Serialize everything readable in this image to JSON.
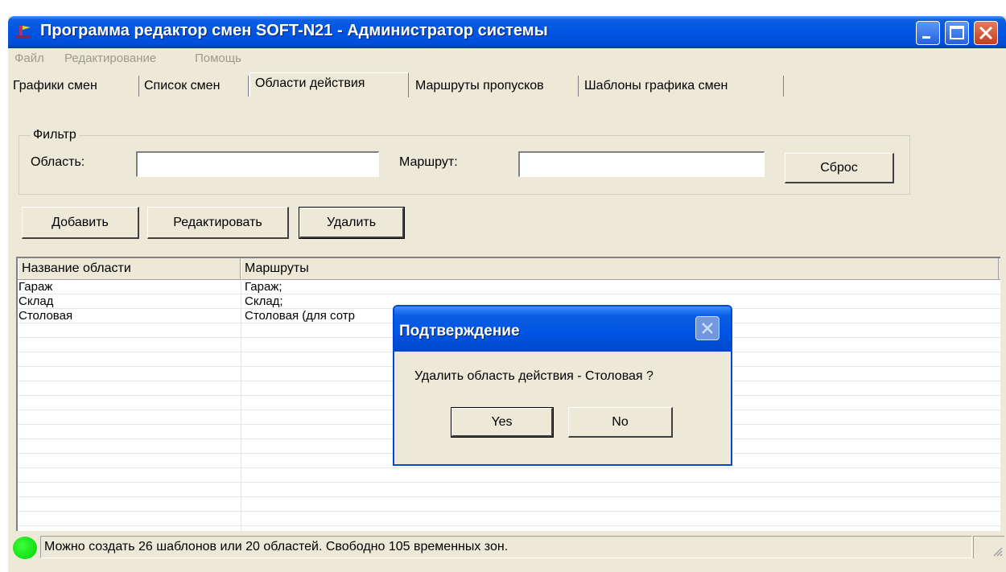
{
  "window": {
    "title": "Программа редактор смен SOFT-N21 - Администратор системы"
  },
  "menu": [
    "Файл",
    "Редактирование",
    "Помощь"
  ],
  "tabs": [
    {
      "label": "Графики смен"
    },
    {
      "label": "Список смен"
    },
    {
      "label": "Области действия",
      "active": true
    },
    {
      "label": "Маршруты пропусков"
    },
    {
      "label": "Шаблоны графика смен"
    }
  ],
  "filter": {
    "legend": "Фильтр",
    "area_label": "Область:",
    "area_value": "",
    "route_label": "Маршрут:",
    "route_value": "",
    "reset_label": "Сброс"
  },
  "toolbar": {
    "add_label": "Добавить",
    "edit_label": "Редактировать",
    "delete_label": "Удалить"
  },
  "table": {
    "columns": [
      "Название области",
      "Маршруты"
    ],
    "rows": [
      [
        "Гараж",
        "Гараж;"
      ],
      [
        "Склад",
        "Склад;"
      ],
      [
        "Столовая",
        "Столовая (для сотр"
      ]
    ]
  },
  "status": {
    "text": "Можно создать 26 шаблонов или 20 областей. Свободно 105 временных зон.",
    "led_color": "#00d000"
  },
  "dialog": {
    "title": "Подтверждение",
    "message": "Удалить область действия - Столовая ?",
    "yes_label": "Yes",
    "no_label": "No"
  },
  "colors": {
    "titlebar": "#0054e3",
    "face": "#ece9d8"
  }
}
